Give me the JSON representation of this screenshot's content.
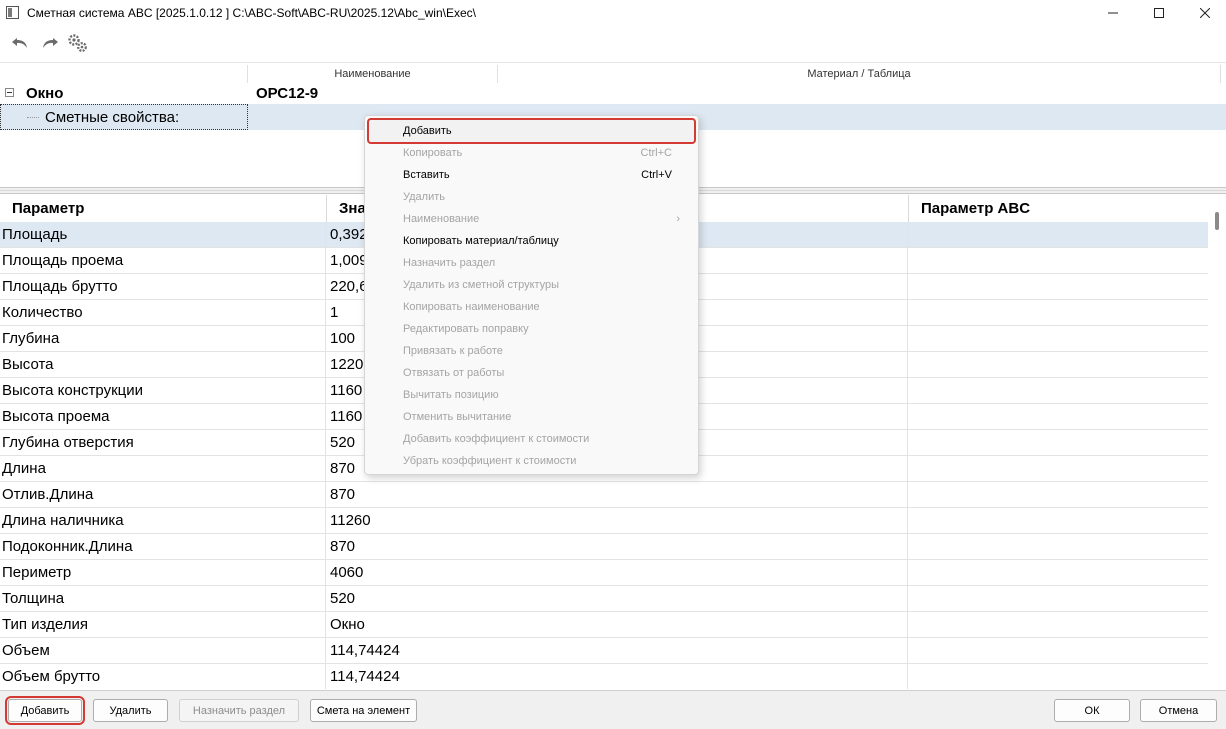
{
  "window": {
    "title": "Сметная система ABC [2025.1.0.12 ]   C:\\ABC-Soft\\ABC-RU\\2025.12\\Abc_win\\Exec\\",
    "min_icon": "minimize-icon",
    "max_icon": "maximize-icon",
    "close_icon": "close-icon"
  },
  "toolbar": {
    "icons": [
      "undo-icon",
      "redo-icon",
      "settings-gears-icon"
    ]
  },
  "tree": {
    "col_name": "Наименование",
    "col_material": "Материал / Таблица",
    "node_label": "Окно",
    "node_value": "ОРС12-9",
    "props_label": "Сметные свойства:"
  },
  "grid": {
    "headers": {
      "param": "Параметр",
      "value": "Зна",
      "abc": "Параметр ABC"
    },
    "rows": [
      {
        "param": "Площадь",
        "value": "0,392",
        "abc": ""
      },
      {
        "param": "Площадь проема",
        "value": "1,009",
        "abc": ""
      },
      {
        "param": "Площадь брутто",
        "value": "220,6",
        "abc": ""
      },
      {
        "param": "Количество",
        "value": "1",
        "abc": ""
      },
      {
        "param": "Глубина",
        "value": "100",
        "abc": ""
      },
      {
        "param": "Высота",
        "value": "1220",
        "abc": ""
      },
      {
        "param": "Высота конструкции",
        "value": "1160",
        "abc": ""
      },
      {
        "param": "Высота проема",
        "value": "1160",
        "abc": ""
      },
      {
        "param": "Глубина отверстия",
        "value": "520",
        "abc": ""
      },
      {
        "param": "Длина",
        "value": "870",
        "abc": ""
      },
      {
        "param": "Отлив.Длина",
        "value": "870",
        "abc": ""
      },
      {
        "param": "Длина наличника",
        "value": "11260",
        "abc": ""
      },
      {
        "param": "Подоконник.Длина",
        "value": "870",
        "abc": ""
      },
      {
        "param": "Периметр",
        "value": "4060",
        "abc": ""
      },
      {
        "param": "Толщина",
        "value": "520",
        "abc": ""
      },
      {
        "param": "Тип изделия",
        "value": "Окно",
        "abc": ""
      },
      {
        "param": "Объем",
        "value": "114,74424",
        "abc": ""
      },
      {
        "param": "Объем брутто",
        "value": "114,74424",
        "abc": ""
      }
    ]
  },
  "context_menu": {
    "items": [
      {
        "label": "Добавить",
        "shortcut": "",
        "enabled": true,
        "highlighted": true
      },
      {
        "label": "Копировать",
        "shortcut": "Ctrl+C",
        "enabled": false
      },
      {
        "label": "Вставить",
        "shortcut": "Ctrl+V",
        "enabled": true
      },
      {
        "label": "Удалить",
        "shortcut": "",
        "enabled": false
      },
      {
        "label": "Наименование",
        "shortcut": "",
        "enabled": false,
        "submenu": true
      },
      {
        "label": "Копировать материал/таблицу",
        "shortcut": "",
        "enabled": true
      },
      {
        "label": "Назначить раздел",
        "shortcut": "",
        "enabled": false
      },
      {
        "label": "Удалить из сметной структуры",
        "shortcut": "",
        "enabled": false
      },
      {
        "label": "Копировать наименование",
        "shortcut": "",
        "enabled": false
      },
      {
        "label": "Редактировать поправку",
        "shortcut": "",
        "enabled": false
      },
      {
        "label": "Привязать к работе",
        "shortcut": "",
        "enabled": false
      },
      {
        "label": "Отвязать от работы",
        "shortcut": "",
        "enabled": false
      },
      {
        "label": "Вычитать позицию",
        "shortcut": "",
        "enabled": false
      },
      {
        "label": "Отменить вычитание",
        "shortcut": "",
        "enabled": false
      },
      {
        "label": "Добавить коэффициент к стоимости",
        "shortcut": "",
        "enabled": false
      },
      {
        "label": "Убрать коэффициент к стоимости",
        "shortcut": "",
        "enabled": false
      }
    ]
  },
  "bottom": {
    "add": "Добавить",
    "delete": "Удалить",
    "assign_section": "Назначить раздел",
    "estimate": "Смета на элемент",
    "ok": "ОК",
    "cancel": "Отмена"
  },
  "colors": {
    "selection": "#dde8f3",
    "highlight_border": "#d33a33"
  }
}
